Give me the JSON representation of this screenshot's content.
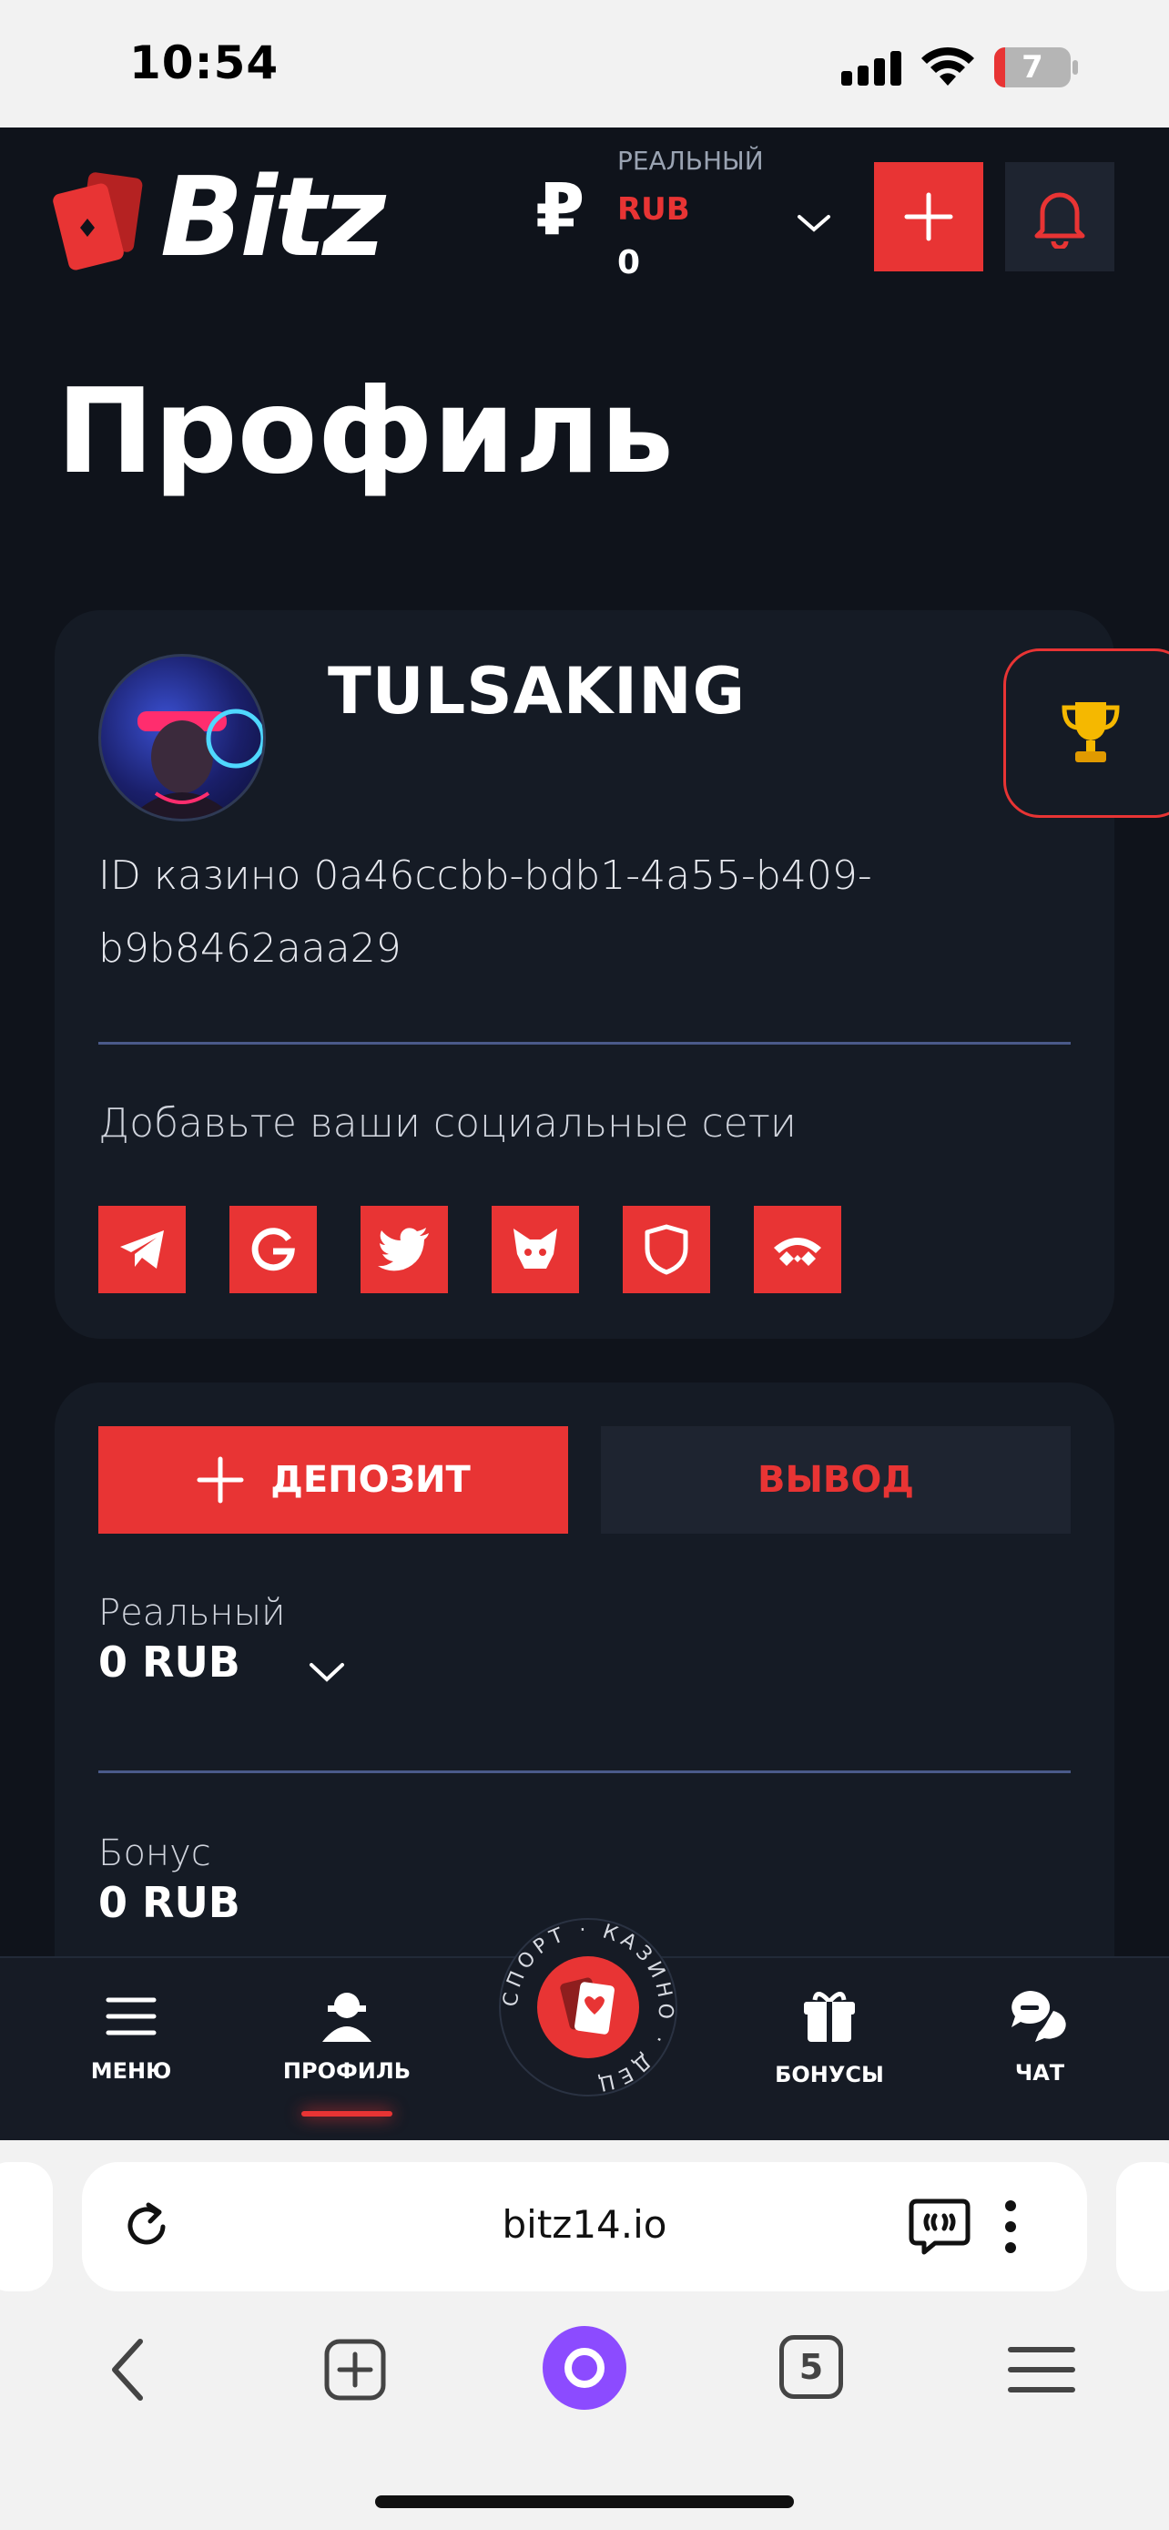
{
  "status_bar": {
    "time": "10:54",
    "battery": "7"
  },
  "header": {
    "logo_text": "Bitz",
    "currency_symbol": "₽",
    "account_type": "РЕАЛЬНЫЙ",
    "currency": "RUB",
    "balance": "0"
  },
  "page": {
    "title": "Профиль"
  },
  "profile": {
    "username": "TULSAKING",
    "casino_id_line1": "ID казино 0a46ccbb-bdb1-4a55-b409-",
    "casino_id_line2": "b9b8462aaa29",
    "social_prompt": "Добавьте ваши социальные сети",
    "socials": [
      "telegram-icon",
      "google-icon",
      "twitter-icon",
      "metamask-icon",
      "shield-icon",
      "walletconnect-icon"
    ]
  },
  "wallet": {
    "deposit_label": "ДЕПОЗИТ",
    "withdraw_label": "ВЫВОД",
    "real_label": "Реальный",
    "real_value": "0 RUB",
    "bonus_label": "Бонус",
    "bonus_value": "0 RUB"
  },
  "bottom_nav": {
    "menu": "МЕНЮ",
    "profile": "ПРОФИЛЬ",
    "center_ring_text": "СПОРТ · КАЗИНО · ДЕЦ",
    "bonuses": "БОНУСЫ",
    "chat": "ЧАТ"
  },
  "browser": {
    "url": "bitz14.io",
    "tabs_count": "5"
  },
  "colors": {
    "accent": "#e83434",
    "bg": "#0f131b",
    "card": "#151b25"
  }
}
